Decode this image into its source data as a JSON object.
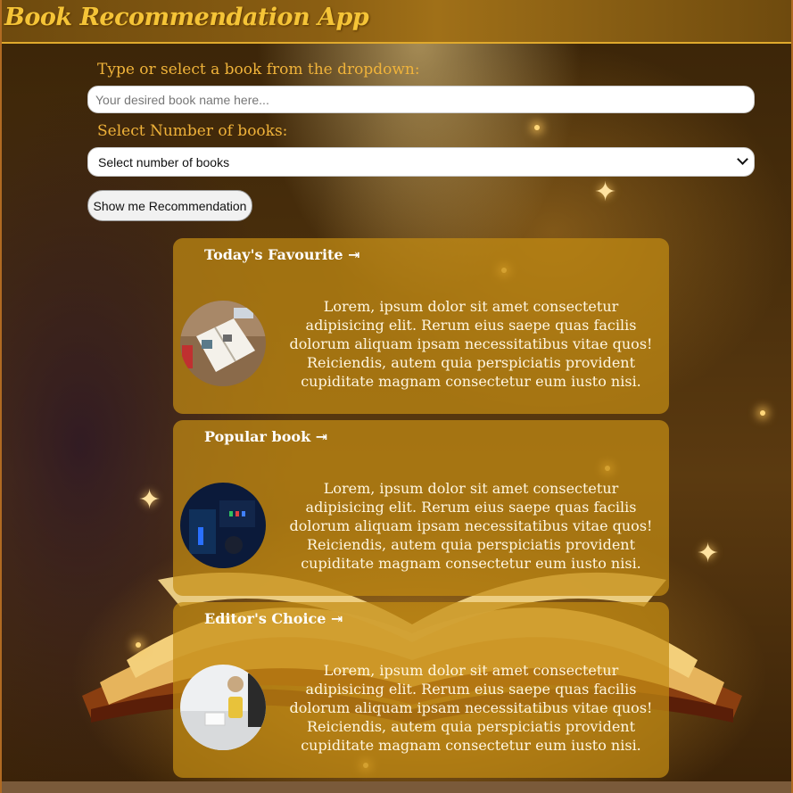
{
  "app": {
    "title": "Book Recommendation App"
  },
  "search": {
    "label": "Type or select a book from the dropdown:",
    "placeholder": "Your desired book name here..."
  },
  "count": {
    "label": "Select Number of books:",
    "selected": "Select number of books"
  },
  "action": {
    "button_label": "Show me Recommendation"
  },
  "cards": [
    {
      "title": "Today's Favourite ⇥",
      "text": "Lorem, ipsum dolor sit amet consectetur adipisicing elit. Rerum eius saepe quas facilis dolorum aliquam ipsam necessitatibus vitae quos! Reiciendis, autem quia perspiciatis provident cupiditate magnam consectetur eum iusto nisi."
    },
    {
      "title": "Popular book ⇥",
      "text": "Lorem, ipsum dolor sit amet consectetur adipisicing elit. Rerum eius saepe quas facilis dolorum aliquam ipsam necessitatibus vitae quos! Reiciendis, autem quia perspiciatis provident cupiditate magnam consectetur eum iusto nisi."
    },
    {
      "title": "Editor's Choice ⇥",
      "text": "Lorem, ipsum dolor sit amet consectetur adipisicing elit. Rerum eius saepe quas facilis dolorum aliquam ipsam necessitatibus vitae quos! Reiciendis, autem quia perspiciatis provident cupiditate magnam consectetur eum iusto nisi."
    }
  ],
  "colors": {
    "accent": "#f0b33a",
    "card": "#c48c14",
    "header_text": "#f5c437"
  }
}
